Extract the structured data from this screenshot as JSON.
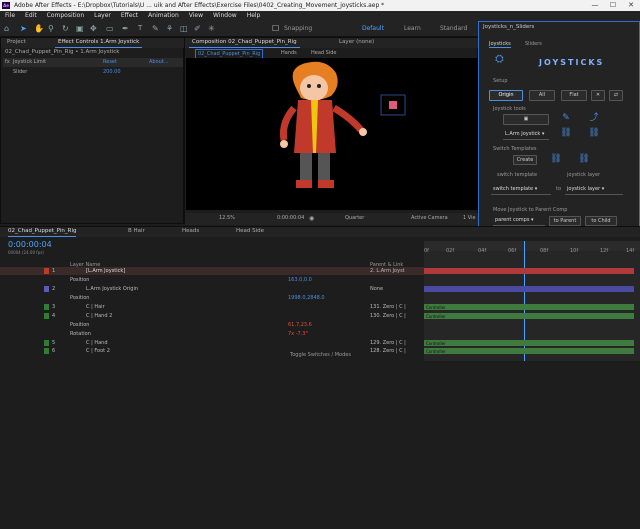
{
  "title": "Adobe After Effects - E:\\Dropbox\\Tutorials\\U ... uik and After Effects\\Exercise Files\\0402_Creating_Movement_joysticks.aep *",
  "app_icon": "Ae",
  "window_controls": {
    "minimize": "—",
    "maximize": "☐",
    "close": "✕"
  },
  "menu": [
    "File",
    "Edit",
    "Composition",
    "Layer",
    "Effect",
    "Animation",
    "View",
    "Window",
    "Help"
  ],
  "toolbar": {
    "snapping_label": "Snapping",
    "workspaces": [
      "Default",
      "Learn",
      "Standard"
    ]
  },
  "project_panel": {
    "tabs": [
      "Project",
      "Effect Controls 1.Arm Joystick"
    ],
    "comp_name": "02_Chad_Puppet_Pin_Rig • 1.Arm Joystick",
    "effect": {
      "name": "Joystick Limit",
      "reset": "Reset",
      "about": "About...",
      "slider_label": "Slider",
      "slider_value": "200.00"
    }
  },
  "comp_panel": {
    "tab": "Composition 02_Chad_Puppet_Pin_Rig",
    "layer_tab": "Layer (none)",
    "breadcrumbs": [
      "02_Chad_Puppet_Pin_Rig",
      "Hands",
      "Head Side"
    ],
    "zoom": "12.5%",
    "timecode": "0:00:00:04",
    "resolution": "Quarter",
    "camera": "Active Camera",
    "views": "1 Vie"
  },
  "joysticks": {
    "panel_title": "Joysticks_n_Sliders",
    "tabs": [
      "Joysticks",
      "Sliders"
    ],
    "logo_text": "JOYSTICKS",
    "setup_label": "Setup",
    "setup_buttons": [
      "Origin",
      "All",
      "Flat"
    ],
    "joystick_tools_label": "Joystick tools",
    "layer_select": "L.Arm Joystick",
    "switch_templates_label": "Switch Templates",
    "create_label": "Create",
    "switch_template_label": "switch template",
    "to_label": "to",
    "joystick_layer_label": "joystick layer",
    "switch_template_select": "switch template",
    "joystick_layer_select": "joystick layer",
    "move_label": "Move Joystick to Parent Comp",
    "parent_select": "parent comps",
    "to_parent": "to Parent",
    "to_child": "to Child"
  },
  "timeline": {
    "tabs": [
      "02_Chad_Puppet_Pin_Rig",
      "B Hair",
      "Heads",
      "Head Side"
    ],
    "timecode": "0:00:00:04",
    "frame_sub": "00004 (24.00 fps)",
    "columns": {
      "layer_name": "Layer Name",
      "parent": "Parent & Link"
    },
    "ruler": [
      "0f",
      "02f",
      "04f",
      "06f",
      "08f",
      "10f",
      "12f",
      "14f"
    ],
    "layers": [
      {
        "num": "1",
        "name": "[L.Arm Joystick]",
        "parent": "2. L.Arm Joyst",
        "color": "#c0392b"
      },
      {
        "num": "",
        "name": "Position",
        "value": "163.0,0.0"
      },
      {
        "num": "2",
        "name": "L.Arm Joystick Origin",
        "parent": "None",
        "color": "#5a5ab8"
      },
      {
        "num": "",
        "name": "Position",
        "value": "1998.0,2848.0"
      },
      {
        "num": "3",
        "name": "C | Hair",
        "parent": "131. Zero | C |",
        "color": "#2e7d32"
      },
      {
        "num": "4",
        "name": "C | Hand 2",
        "parent": "130. Zero | C |",
        "color": "#2e7d32"
      },
      {
        "num": "",
        "name": "Position",
        "value": "61.7,23.6"
      },
      {
        "num": "",
        "name": "Rotation",
        "value": "7x -7.3°"
      },
      {
        "num": "5",
        "name": "C | Hand",
        "parent": "129. Zero | C |",
        "color": "#2e7d32"
      },
      {
        "num": "6",
        "name": "C | Foot 2",
        "parent": "128. Zero | C |",
        "color": "#2e7d32"
      }
    ],
    "bar_labels": [
      "Controller",
      "Controller",
      "Controller",
      "Controller"
    ],
    "footer": "Toggle Switches / Modes"
  }
}
